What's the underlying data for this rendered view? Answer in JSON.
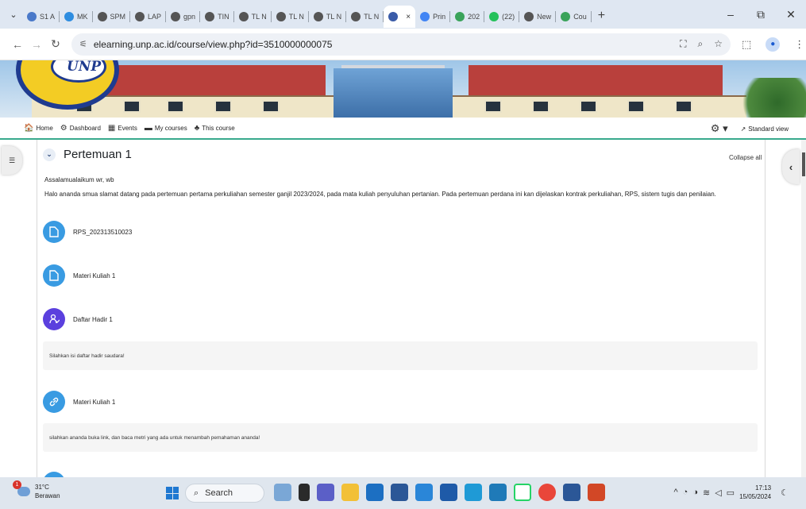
{
  "browser": {
    "tabs": [
      {
        "label": "S1 A",
        "color": "#4a79c9"
      },
      {
        "label": "MK",
        "color": "#2e8de0"
      },
      {
        "label": "SPM",
        "color": "#555555"
      },
      {
        "label": "LAP",
        "color": "#555555"
      },
      {
        "label": "gpn",
        "color": "#555555"
      },
      {
        "label": "TIN",
        "color": "#555555"
      },
      {
        "label": "TL N",
        "color": "#555555"
      },
      {
        "label": "TL N",
        "color": "#555555"
      },
      {
        "label": "TL N",
        "color": "#555555"
      },
      {
        "label": "TL N",
        "color": "#555555"
      }
    ],
    "active_tab": {
      "label": "",
      "close": "×"
    },
    "tabs_after": [
      {
        "label": "Prin",
        "color": "#4285f4"
      },
      {
        "label": "202",
        "color": "#3aa35a"
      },
      {
        "label": "(22)",
        "color": "#25c15b"
      },
      {
        "label": "New",
        "color": "#555555"
      },
      {
        "label": "Cou",
        "color": "#3aa35a"
      }
    ],
    "new_tab_label": "+",
    "window_controls": {
      "minimize": "–",
      "restore": "⧉",
      "close": "✕"
    },
    "url": "elearning.unp.ac.id/course/view.php?id=3510000000075"
  },
  "banner": {
    "logo_text": "UNP"
  },
  "navbar": {
    "items": [
      {
        "label": "Home",
        "icon": "home-icon",
        "glyph": "🏠"
      },
      {
        "label": "Dashboard",
        "icon": "dashboard-icon",
        "glyph": "⚙"
      },
      {
        "label": "Events",
        "icon": "calendar-icon",
        "glyph": "▦"
      },
      {
        "label": "My courses",
        "icon": "courses-icon",
        "glyph": "▬"
      },
      {
        "label": "This course",
        "icon": "sitemap-icon",
        "glyph": "♣"
      }
    ],
    "settings_glyph": "⚙ ▾",
    "standard_view": "Standard view"
  },
  "course": {
    "section_title": "Pertemuan 1",
    "collapse_all": "Collapse all",
    "summary_line1": "Assalamualaikum wr, wb",
    "summary_line2": "Halo ananda smua slamat datang pada pertemuan pertama perkuliahan semester ganjil 2023/2024, pada mata kuliah penyuluhan pertanian. Pada pertemuan perdana ini kan dijelaskan kontrak perkuliahan, RPS, sistem tugis dan penilaian.",
    "activities": [
      {
        "name": "RPS_202313510023",
        "type": "file",
        "icon": "file-icon",
        "color": "#399be2"
      },
      {
        "name": "Materi Kuliah 1",
        "type": "file",
        "icon": "file-icon",
        "color": "#399be2"
      },
      {
        "name": "Daftar Hadir 1",
        "type": "attendance",
        "icon": "attendance-icon",
        "color": "#5b40de"
      },
      {
        "name": "Materi Kuliah 1",
        "type": "url",
        "icon": "link-icon",
        "color": "#399be2"
      }
    ],
    "descriptions": [
      "Silahkan isi daftar hadir saudara!",
      "silahkan ananda buka link, dan baca metri yang ada untuk menambah pemahaman ananda!"
    ]
  },
  "taskbar": {
    "weather_temp": "31°C",
    "weather_desc": "Berawan",
    "weather_badge": "1",
    "search_placeholder": "Search",
    "time": "17:13",
    "date": "15/05/2024"
  }
}
